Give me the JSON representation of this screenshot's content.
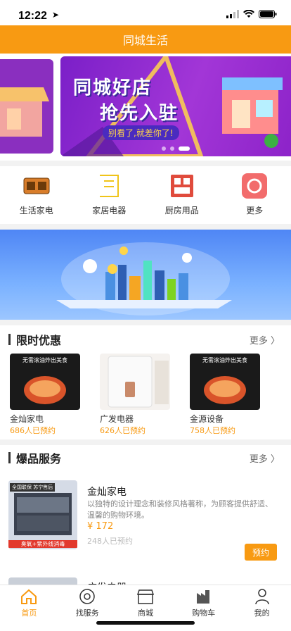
{
  "status": {
    "time": "12:22"
  },
  "nav": {
    "title": "同城生活"
  },
  "banner": {
    "line1": "同城好店",
    "line2": "抢先入驻",
    "tagline": "别看了,就差你了!"
  },
  "categories": [
    {
      "label": "生活家电",
      "icon": "appliance-icon"
    },
    {
      "label": "家居电器",
      "icon": "home-appliance-icon"
    },
    {
      "label": "厨房用品",
      "icon": "kitchen-icon"
    },
    {
      "label": "更多",
      "icon": "more-icon"
    }
  ],
  "limited": {
    "title": "限时优惠",
    "more": "更多 〉",
    "items": [
      {
        "name": "金灿家电",
        "count": "686人已预约",
        "banner": "无需滚油炸出美食"
      },
      {
        "name": "广发电器",
        "count": "626人已预约",
        "banner": ""
      },
      {
        "name": "金源设备",
        "count": "758人已预约",
        "banner": "无需滚油炸出美食"
      }
    ]
  },
  "hot": {
    "title": "爆品服务",
    "more": "更多 〉",
    "product": {
      "name": "金灿家电",
      "desc": "以独特的设计理念和装修风格著称，为顾客提供舒适、温馨的购物环境。",
      "price": "¥ 172",
      "count": "248人已预约",
      "button": "预约",
      "img_top": "全国联保 苏宁售后",
      "img_bottom": "臭氧+紫外线消毒"
    },
    "product2_name": "广发电器"
  },
  "tabs": [
    {
      "label": "首页",
      "icon": "home-icon"
    },
    {
      "label": "找服务",
      "icon": "service-icon"
    },
    {
      "label": "商城",
      "icon": "shop-icon"
    },
    {
      "label": "购物车",
      "icon": "cart-icon"
    },
    {
      "label": "我的",
      "icon": "user-icon"
    }
  ],
  "colors": {
    "accent": "#f89a12",
    "banner_purple": "#8a2fbf"
  }
}
